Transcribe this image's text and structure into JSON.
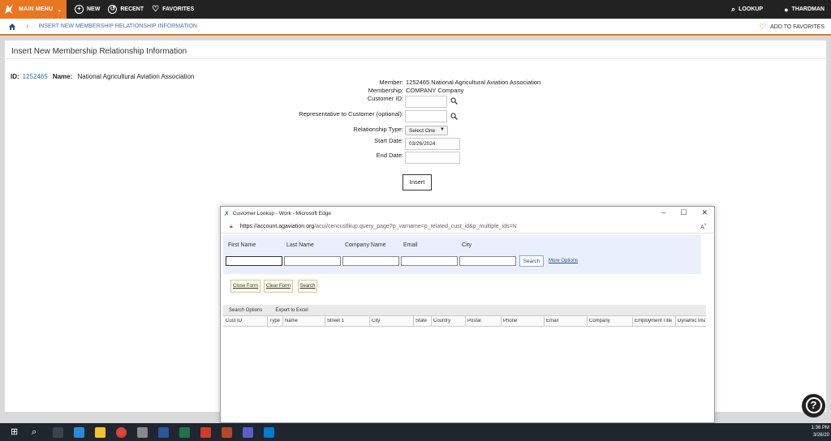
{
  "topbar": {
    "main_menu": "MAIN MENU",
    "new": "NEW",
    "recent": "RECENT",
    "favorites": "FAVORITES",
    "lookup": "LOOKUP",
    "user": "THARDMAN"
  },
  "breadcrumb": {
    "current": "INSERT NEW MEMBERSHIP RELATIONSHIP INFORMATION",
    "add_to_favorites": "ADD TO FAVORITES"
  },
  "page": {
    "title": "Insert New Membership Relationship Information",
    "id_label": "ID:",
    "id_value": "1252465",
    "name_label": "Name:",
    "name_value": "National Agricultural Aviation Association"
  },
  "form": {
    "member_label": "Member:",
    "member_value": "1252465 National Agricultural Aviation Association",
    "membership_label": "Membership:",
    "membership_value": "COMPANY Company",
    "customer_id_label": "Customer ID:",
    "representative_label": "Representative to Customer (optional):",
    "relationship_label": "Relationship Type:",
    "relationship_value": "Select One",
    "start_date_label": "Start Date:",
    "start_date_value": "03/26/2024",
    "end_date_label": "End Date:",
    "insert_button": "Insert"
  },
  "popup": {
    "window_title": "Customer Lookup - Work - Microsoft Edge",
    "url_host": "https://account.agaviation.org",
    "url_path": "/acui/cencustlkup.query_page?p_varname=p_related_cust_id&p_multiple_ids=N",
    "first_name": "First Name",
    "last_name": "Last Name",
    "company_name": "Company Name",
    "email": "Email",
    "city": "City",
    "search_button": "Search",
    "more_options": "More Options",
    "close_form": "Close Form",
    "clear_form": "Clear Form",
    "search_small": "Search",
    "search_options": "Search Options",
    "export_to_excel": "Export to Excel",
    "columns": [
      "Cust ID",
      "Type",
      "Name",
      "Street 1",
      "City",
      "State",
      "Country",
      "Postal",
      "Phone",
      "Email",
      "Company",
      "Employment Title",
      "Dynamic Ima"
    ]
  },
  "taskbar": {
    "time": "1:36 PM",
    "date": "3/26/20"
  },
  "colors": {
    "accent": "#e87722",
    "topbar": "#222222",
    "link": "#2a6fb7"
  }
}
